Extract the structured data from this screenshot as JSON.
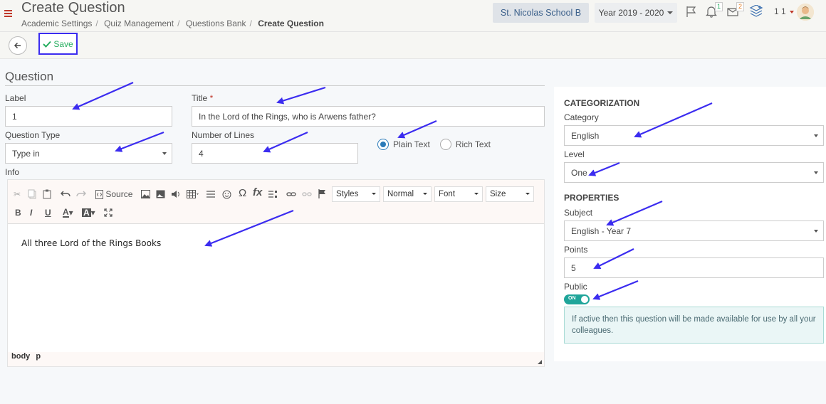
{
  "header": {
    "title": "Create Question",
    "breadcrumb": [
      "Academic Settings",
      "Quiz Management",
      "Questions Bank",
      "Create Question"
    ],
    "school": "St. Nicolas School B",
    "year": "Year 2019 - 2020",
    "notifications_count": "1",
    "messages_count": "2",
    "user_number": "1 1"
  },
  "actions": {
    "save_label": "Save"
  },
  "question": {
    "section_title": "Question",
    "label_label": "Label",
    "label_value": "1",
    "title_label": "Title",
    "title_required": "*",
    "title_value": "In the Lord of the Rings, who is Arwens father?",
    "type_label": "Question Type",
    "type_value": "Type in",
    "lines_label": "Number of Lines",
    "lines_value": "4",
    "format_options": [
      "Plain Text",
      "Rich Text"
    ],
    "format_selected": "Plain Text",
    "info_label": "Info"
  },
  "editor": {
    "source_label": "Source",
    "styles_label": "Styles",
    "format_label": "Normal",
    "font_label": "Font",
    "size_label": "Size",
    "content": "All three Lord of the Rings Books",
    "path": [
      "body",
      "p"
    ]
  },
  "categorization": {
    "heading": "CATEGORIZATION",
    "category_label": "Category",
    "category_value": "English",
    "level_label": "Level",
    "level_value": "One"
  },
  "properties": {
    "heading": "PROPERTIES",
    "subject_label": "Subject",
    "subject_value": "English - Year 7",
    "points_label": "Points",
    "points_value": "5",
    "public_label": "Public",
    "public_state": "ON",
    "public_info": "If active then this question will be made available for use by all your colleagues."
  },
  "colors": {
    "accent": "#2b7bb9",
    "save": "#27ae60",
    "annotation": "#3b2cf0",
    "toggle": "#1fa59a"
  }
}
